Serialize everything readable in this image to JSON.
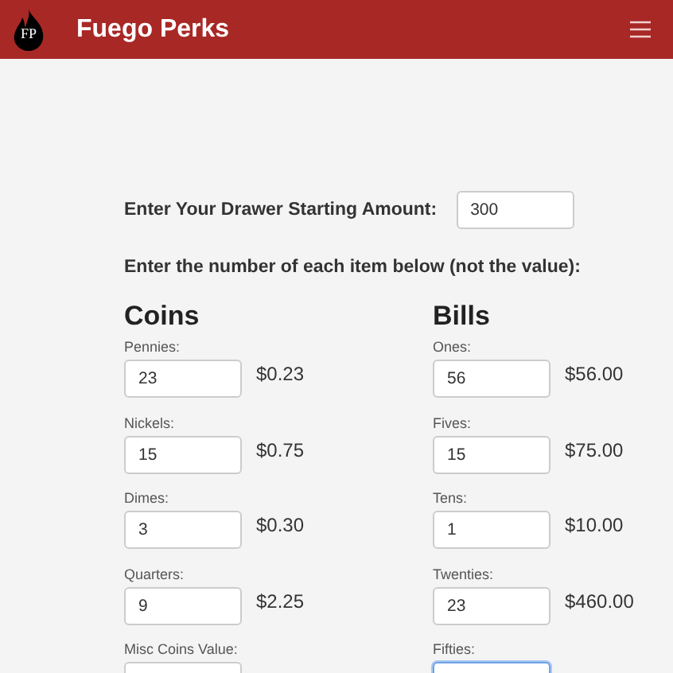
{
  "header": {
    "logo_text": "FP",
    "title": "Fuego Perks"
  },
  "starting_amount": {
    "label": "Enter Your Drawer Starting Amount:",
    "value": "300"
  },
  "instruction": "Enter the number of each item below (not the value):",
  "columns": [
    {
      "heading": "Coins",
      "items": [
        {
          "label": "Pennies:",
          "value": "23",
          "total": "$0.23",
          "focused": false
        },
        {
          "label": "Nickels:",
          "value": "15",
          "total": "$0.75",
          "focused": false
        },
        {
          "label": "Dimes:",
          "value": "3",
          "total": "$0.30",
          "focused": false
        },
        {
          "label": "Quarters:",
          "value": "9",
          "total": "$2.25",
          "focused": false
        },
        {
          "label": "Misc Coins Value:",
          "focused": false
        }
      ]
    },
    {
      "heading": "Bills",
      "items": [
        {
          "label": "Ones:",
          "value": "56",
          "total": "$56.00",
          "focused": false
        },
        {
          "label": "Fives:",
          "value": "15",
          "total": "$75.00",
          "focused": false
        },
        {
          "label": "Tens:",
          "value": "1",
          "total": "$10.00",
          "focused": false
        },
        {
          "label": "Twenties:",
          "value": "23",
          "total": "$460.00",
          "focused": false
        },
        {
          "label": "Fifties:",
          "focused": true
        }
      ]
    }
  ]
}
